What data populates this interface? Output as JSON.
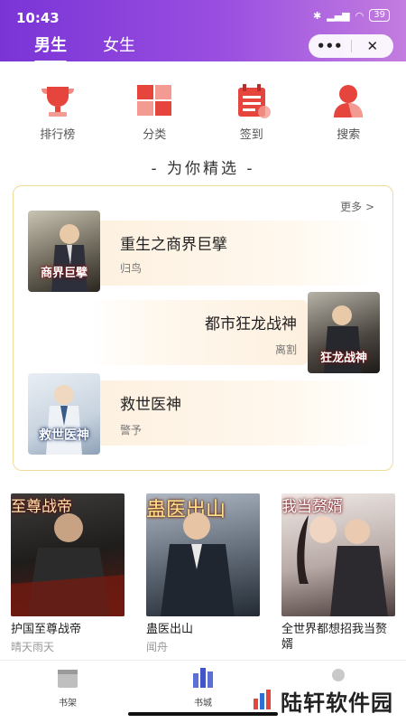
{
  "status_bar": {
    "time": "10:43",
    "battery": "39"
  },
  "gender_tabs": [
    {
      "label": "男生"
    },
    {
      "label": "女生"
    }
  ],
  "capsule": {
    "more": "•••",
    "close": "✕"
  },
  "quick_entries": [
    {
      "label": "排行榜",
      "icon": "trophy-icon"
    },
    {
      "label": "分类",
      "icon": "grid-icon"
    },
    {
      "label": "签到",
      "icon": "calendar-icon"
    },
    {
      "label": "搜索",
      "icon": "person-search-icon"
    }
  ],
  "picks": {
    "title": "- 为你精选 -",
    "more": "更多 >",
    "items": [
      {
        "title": "重生之商界巨擘",
        "author": "归鸟",
        "cover_text": "商界巨擘"
      },
      {
        "title": "都市狂龙战神",
        "author": "离割",
        "cover_text": "狂龙战神"
      },
      {
        "title": "救世医神",
        "author": "警予",
        "cover_text": "救世医神"
      }
    ]
  },
  "books": [
    {
      "title": "护国至尊战帝",
      "author": "晴天雨天",
      "cover_text": "至尊战帝"
    },
    {
      "title": "蛊医出山",
      "author": "闻舟",
      "cover_text": "蛊医出山"
    },
    {
      "title": "全世界都想招我当赘婿",
      "author": "",
      "cover_text": "我当赘婿"
    }
  ],
  "tabbar": [
    {
      "label": "书架"
    },
    {
      "label": "书城"
    },
    {
      "label": ""
    }
  ],
  "watermark": "陆轩软件园",
  "colors": {
    "header_start": "#7a34d6",
    "header_end": "#c37ddf",
    "accent_red": "#e5453d",
    "card_border": "#eedc9a"
  }
}
